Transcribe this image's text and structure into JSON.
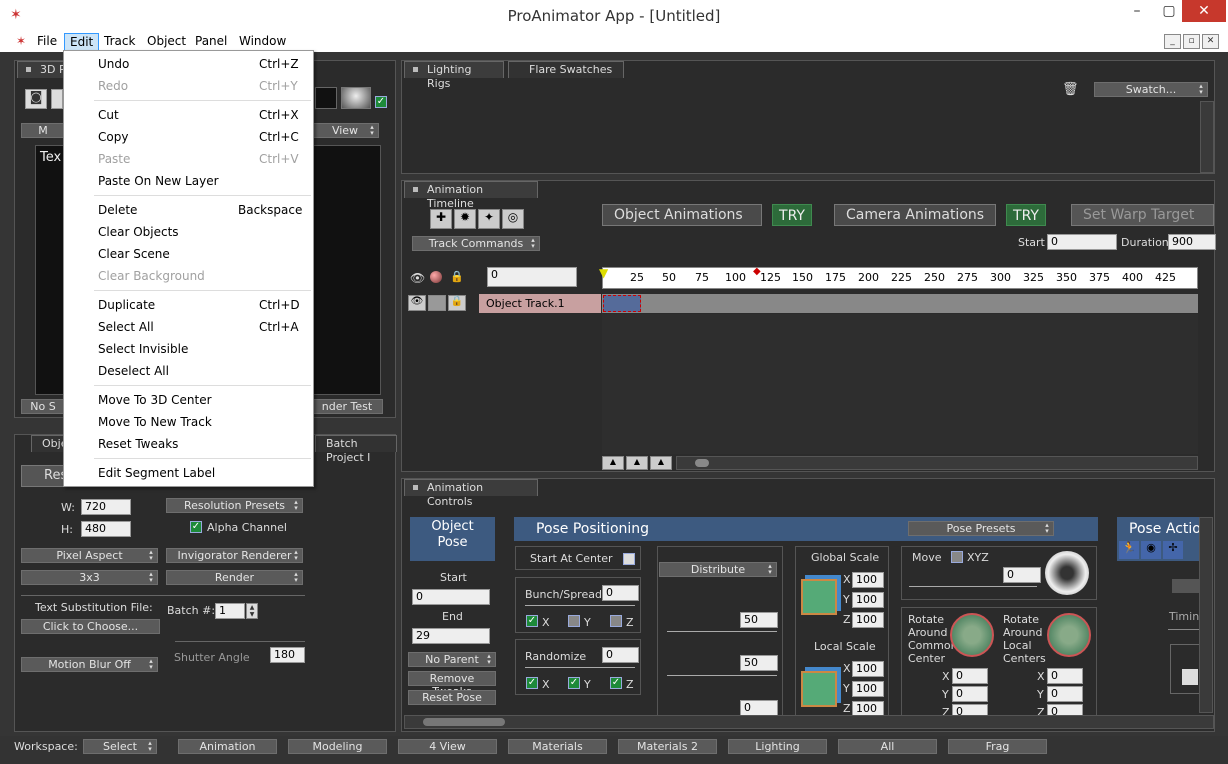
{
  "window": {
    "title": "ProAnimator App - [Untitled]",
    "min": "–",
    "restore": "▢",
    "close": "✕"
  },
  "menubar": {
    "items": [
      "File",
      "Edit",
      "Track",
      "Object",
      "Panel",
      "Window"
    ],
    "mdi": [
      "_",
      "▫",
      "✕"
    ]
  },
  "edit_menu": {
    "items": [
      {
        "label": "Undo",
        "shortcut": "Ctrl+Z",
        "enabled": true
      },
      {
        "label": "Redo",
        "shortcut": "Ctrl+Y",
        "enabled": false
      },
      {
        "label": "Cut",
        "shortcut": "Ctrl+X",
        "enabled": true
      },
      {
        "label": "Copy",
        "shortcut": "Ctrl+C",
        "enabled": true
      },
      {
        "label": "Paste",
        "shortcut": "Ctrl+V",
        "enabled": false
      },
      {
        "label": "Paste On New Layer",
        "shortcut": "",
        "enabled": true
      },
      {
        "label": "Delete",
        "shortcut": "Backspace",
        "enabled": true
      },
      {
        "label": "Clear Objects",
        "shortcut": "",
        "enabled": true
      },
      {
        "label": "Clear Scene",
        "shortcut": "",
        "enabled": true
      },
      {
        "label": "Clear Background",
        "shortcut": "",
        "enabled": false
      },
      {
        "label": "Duplicate",
        "shortcut": "Ctrl+D",
        "enabled": true
      },
      {
        "label": "Select All",
        "shortcut": "Ctrl+A",
        "enabled": true
      },
      {
        "label": "Select Invisible",
        "shortcut": "",
        "enabled": true
      },
      {
        "label": "Deselect All",
        "shortcut": "",
        "enabled": true
      },
      {
        "label": "Move To 3D Center",
        "shortcut": "",
        "enabled": true
      },
      {
        "label": "Move To New Track",
        "shortcut": "",
        "enabled": true
      },
      {
        "label": "Reset Tweaks",
        "shortcut": "",
        "enabled": true
      },
      {
        "label": "Edit Segment Label",
        "shortcut": "",
        "enabled": true
      }
    ]
  },
  "left_top": {
    "tab": "3D P",
    "m_btn": "M",
    "view_dd": "View",
    "tex": "Tex",
    "no_btn": "No S",
    "render_test": "nder Test"
  },
  "left_bottom": {
    "tab1": "Objec",
    "tab2": "Batch Project I",
    "reso_btn": "Reso",
    "w_label": "W:",
    "w_value": "720",
    "h_label": "H:",
    "h_value": "480",
    "res_presets": "Resolution Presets",
    "alpha": "Alpha Channel",
    "pixel_aspect": "Pixel Aspect",
    "invig_renderer": "Invigorator Renderer",
    "grid": "3x3",
    "render": "Render",
    "text_sub_label": "Text Substitution File:",
    "click_choose": "Click to Choose...",
    "batch_label": "Batch #:",
    "batch_value": "1",
    "motion_blur": "Motion Blur Off",
    "shutter_label": "Shutter Angle",
    "shutter_value": "180"
  },
  "lighting": {
    "tabs": [
      "Lighting Rigs",
      "Flare Swatches"
    ],
    "swatch": "Swatch..."
  },
  "timeline": {
    "tab": "Animation Timeline",
    "track_commands": "Track Commands",
    "obj_anims": "Object Animations",
    "try1": "TRY",
    "cam_anims": "Camera Animations",
    "try2": "TRY",
    "warp": "Set Warp Target",
    "start_label": "Start",
    "start_value": "0",
    "duration_label": "Duration",
    "duration_value": "900",
    "frame_value": "0",
    "ruler": [
      "25",
      "50",
      "75",
      "100",
      "125",
      "150",
      "175",
      "200",
      "225",
      "250",
      "275",
      "300",
      "325",
      "350",
      "375",
      "400",
      "425"
    ],
    "track_name": "Object Track.1",
    "transport": [
      "|◀",
      "◀|",
      "▶◀",
      "▶",
      "|▶",
      "▶|"
    ]
  },
  "controls": {
    "tab": "Animation Controls",
    "object_pose": "Object Pose",
    "start_label": "Start",
    "start_value": "0",
    "end_label": "End",
    "end_value": "29",
    "no_parent": "No Parent",
    "remove_tweaks": "Remove Tweaks",
    "reset_pose": "Reset Pose",
    "pose_positioning": "Pose Positioning",
    "pose_presets": "Pose Presets",
    "start_at_center": "Start At Center",
    "distribute": "Distribute",
    "bunch_spread": "Bunch/Spread",
    "bunch_value": "0",
    "randomize": "Randomize",
    "randomize_value": "0",
    "val50a": "50",
    "val50b": "50",
    "val0": "0",
    "x": "X",
    "y": "Y",
    "z": "Z",
    "global_scale": "Global Scale",
    "gs": [
      "100",
      "100",
      "100"
    ],
    "local_scale": "Local Scale",
    "ls": [
      "100",
      "100",
      "100"
    ],
    "move": "Move",
    "xyz": "XYZ",
    "move_value": "0",
    "rotate_common": "Rotate Around Common Center",
    "rotate_local": "Rotate Around Local Centers",
    "rc": [
      "0",
      "0",
      "0"
    ],
    "rl": [
      "0",
      "0",
      "0"
    ],
    "pose_action": "Pose Actio",
    "timing": "Timing"
  },
  "workspace": {
    "label": "Workspace:",
    "select": "Select",
    "items": [
      "Animation",
      "Modeling",
      "4 View",
      "Materials",
      "Materials 2",
      "Lighting",
      "All",
      "Frag"
    ]
  }
}
